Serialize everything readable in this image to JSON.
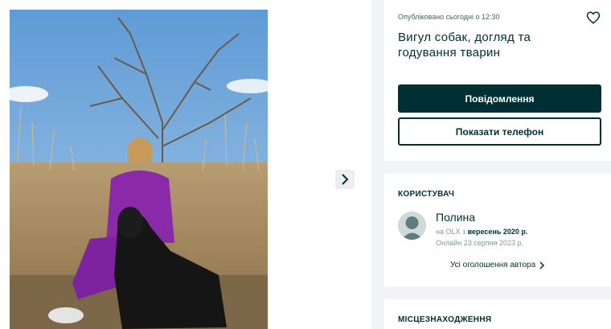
{
  "ad": {
    "posted": "Опубліковано сьогодні о 12:30",
    "title": "Вигул собак, догляд та годування тварин",
    "message_button": "Повідомлення",
    "phone_button": "Показати телефон",
    "icons": {
      "favorite": "heart-icon",
      "next": "chevron-right-icon"
    }
  },
  "user": {
    "section_title": "КОРИСТУВАЧ",
    "name": "Полина",
    "since_prefix": "на OLX з ",
    "since_value": "вересень 2020 р.",
    "online": "Онлайн 23 серпня 2023 р.",
    "all_ads_link": "Усі оголошення автора"
  },
  "location": {
    "section_title": "МІСЦЕЗНАХОДЖЕННЯ"
  },
  "colors": {
    "primary": "#002f34",
    "background": "#f2f4f5",
    "muted": "#7f979e"
  }
}
